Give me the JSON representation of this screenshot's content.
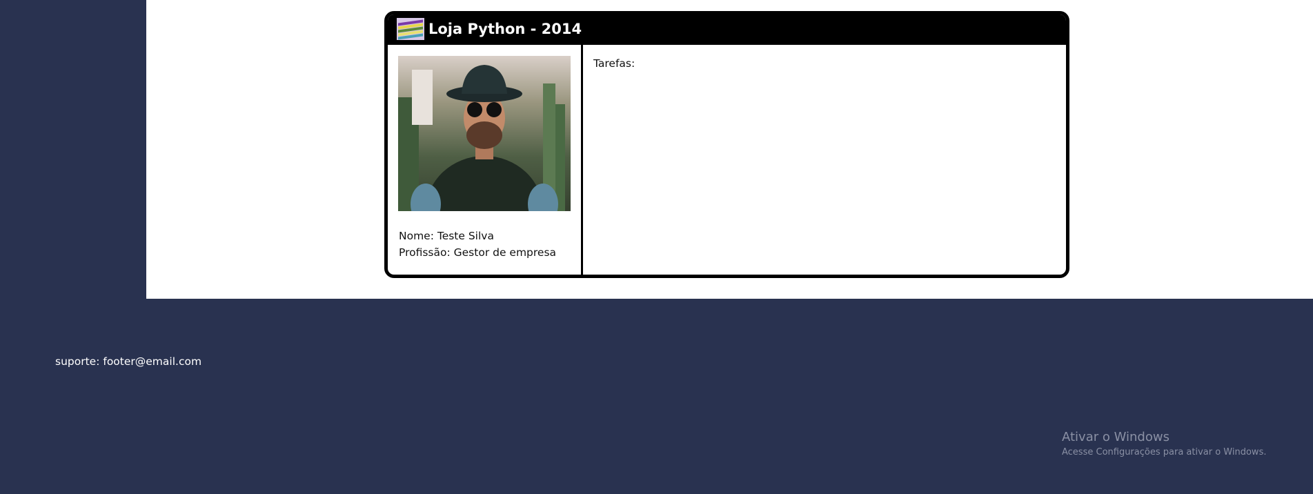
{
  "header": {
    "title": "Loja Python - 2014",
    "logo_icon": "books-stack-icon"
  },
  "profile": {
    "photo_alt": "profile-photo",
    "name_line": "Nome: Teste Silva",
    "profession_line": "Profissão: Gestor de empresa"
  },
  "tasks": {
    "label": "Tarefas:"
  },
  "footer": {
    "support": "suporte: footer@email.com"
  },
  "watermark": {
    "title": "Ativar o Windows",
    "subtitle": "Acesse Configurações para ativar o Windows."
  },
  "colors": {
    "background": "#293250",
    "card_header": "#000000",
    "main": "#ffffff"
  }
}
